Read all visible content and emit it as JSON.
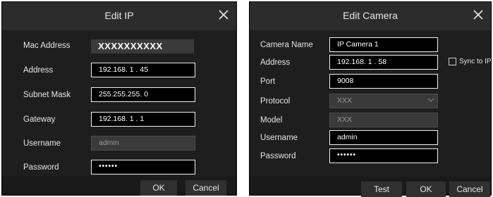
{
  "edit_ip": {
    "title": "Edit IP",
    "fields": {
      "mac_label": "Mac Address",
      "mac_value": "XXXXXXXXXX",
      "address_label": "Address",
      "address_value": "192.168. 1 . 45",
      "subnet_label": "Subnet Mask",
      "subnet_value": "255.255.255. 0",
      "gateway_label": "Gateway",
      "gateway_value": "192.168. 1 . 1",
      "username_label": "Username",
      "username_value": "admin",
      "password_label": "Password",
      "password_value": "••••••"
    },
    "buttons": {
      "ok": "OK",
      "cancel": "Cancel"
    }
  },
  "edit_camera": {
    "title": "Edit Camera",
    "fields": {
      "name_label": "Camera Name",
      "name_value": "IP Camera 1",
      "address_label": "Address",
      "address_value": "192.168. 1 . 58",
      "sync_label": "Sync to IPC",
      "port_label": "Port",
      "port_value": "9008",
      "protocol_label": "Protocol",
      "protocol_value": "XXX",
      "model_label": "Model",
      "model_value": "XXX",
      "username_label": "Username",
      "username_value": "admin",
      "password_label": "Password",
      "password_value": "••••••"
    },
    "buttons": {
      "test": "Test",
      "ok": "OK",
      "cancel": "Cancel"
    }
  },
  "icons": {
    "close": "close-icon",
    "dropdown": "chevron-down-icon"
  },
  "colors": {
    "dialog_bg": "#1e1e1e",
    "titlebar_bg": "#2c2c2c",
    "field_bg": "#000000",
    "field_border": "#f0f0f0",
    "disabled_bg": "#3a3a3a"
  }
}
